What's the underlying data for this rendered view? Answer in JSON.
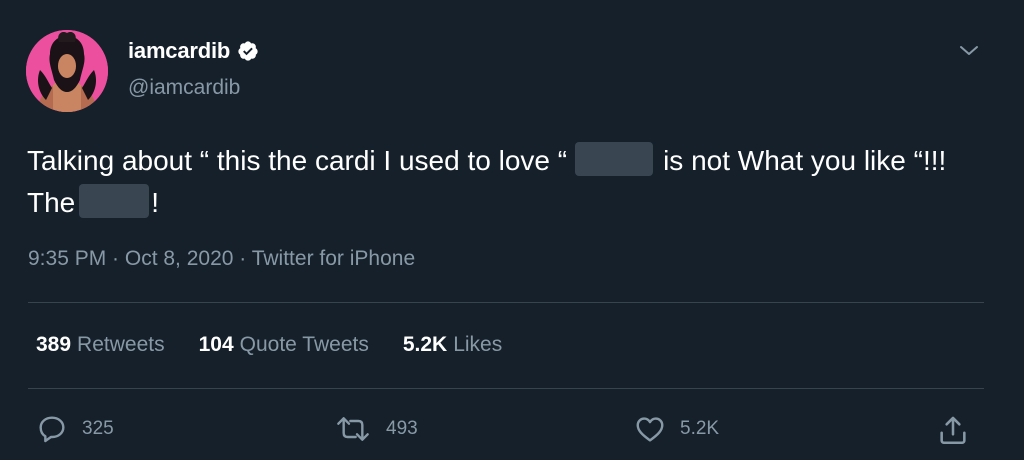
{
  "user": {
    "display_name": "iamcardib",
    "handle": "@iamcardib",
    "verified": true
  },
  "tweet": {
    "text_part1": "Talking about “ this the cardi I used to love “",
    "text_part2": "is not What you like “!!! The",
    "text_part3": "!",
    "timestamp": "9:35 PM · Oct 8, 2020 · Twitter for iPhone"
  },
  "stats": {
    "retweets_count": "389",
    "retweets_label": "Retweets",
    "quotes_count": "104",
    "quotes_label": "Quote Tweets",
    "likes_count": "5.2K",
    "likes_label": "Likes"
  },
  "actions": {
    "reply_count": "325",
    "retweet_count": "493",
    "like_count": "5.2K"
  },
  "colors": {
    "background": "#15202b",
    "primary_text": "#ffffff",
    "secondary_text": "#8899a6",
    "divider": "#38444d",
    "avatar_background": "#ec4f9e"
  },
  "icons": {
    "verified": "verified-badge-icon",
    "more": "chevron-down-icon",
    "reply": "reply-icon",
    "retweet": "retweet-icon",
    "like": "heart-icon",
    "share": "share-icon"
  }
}
